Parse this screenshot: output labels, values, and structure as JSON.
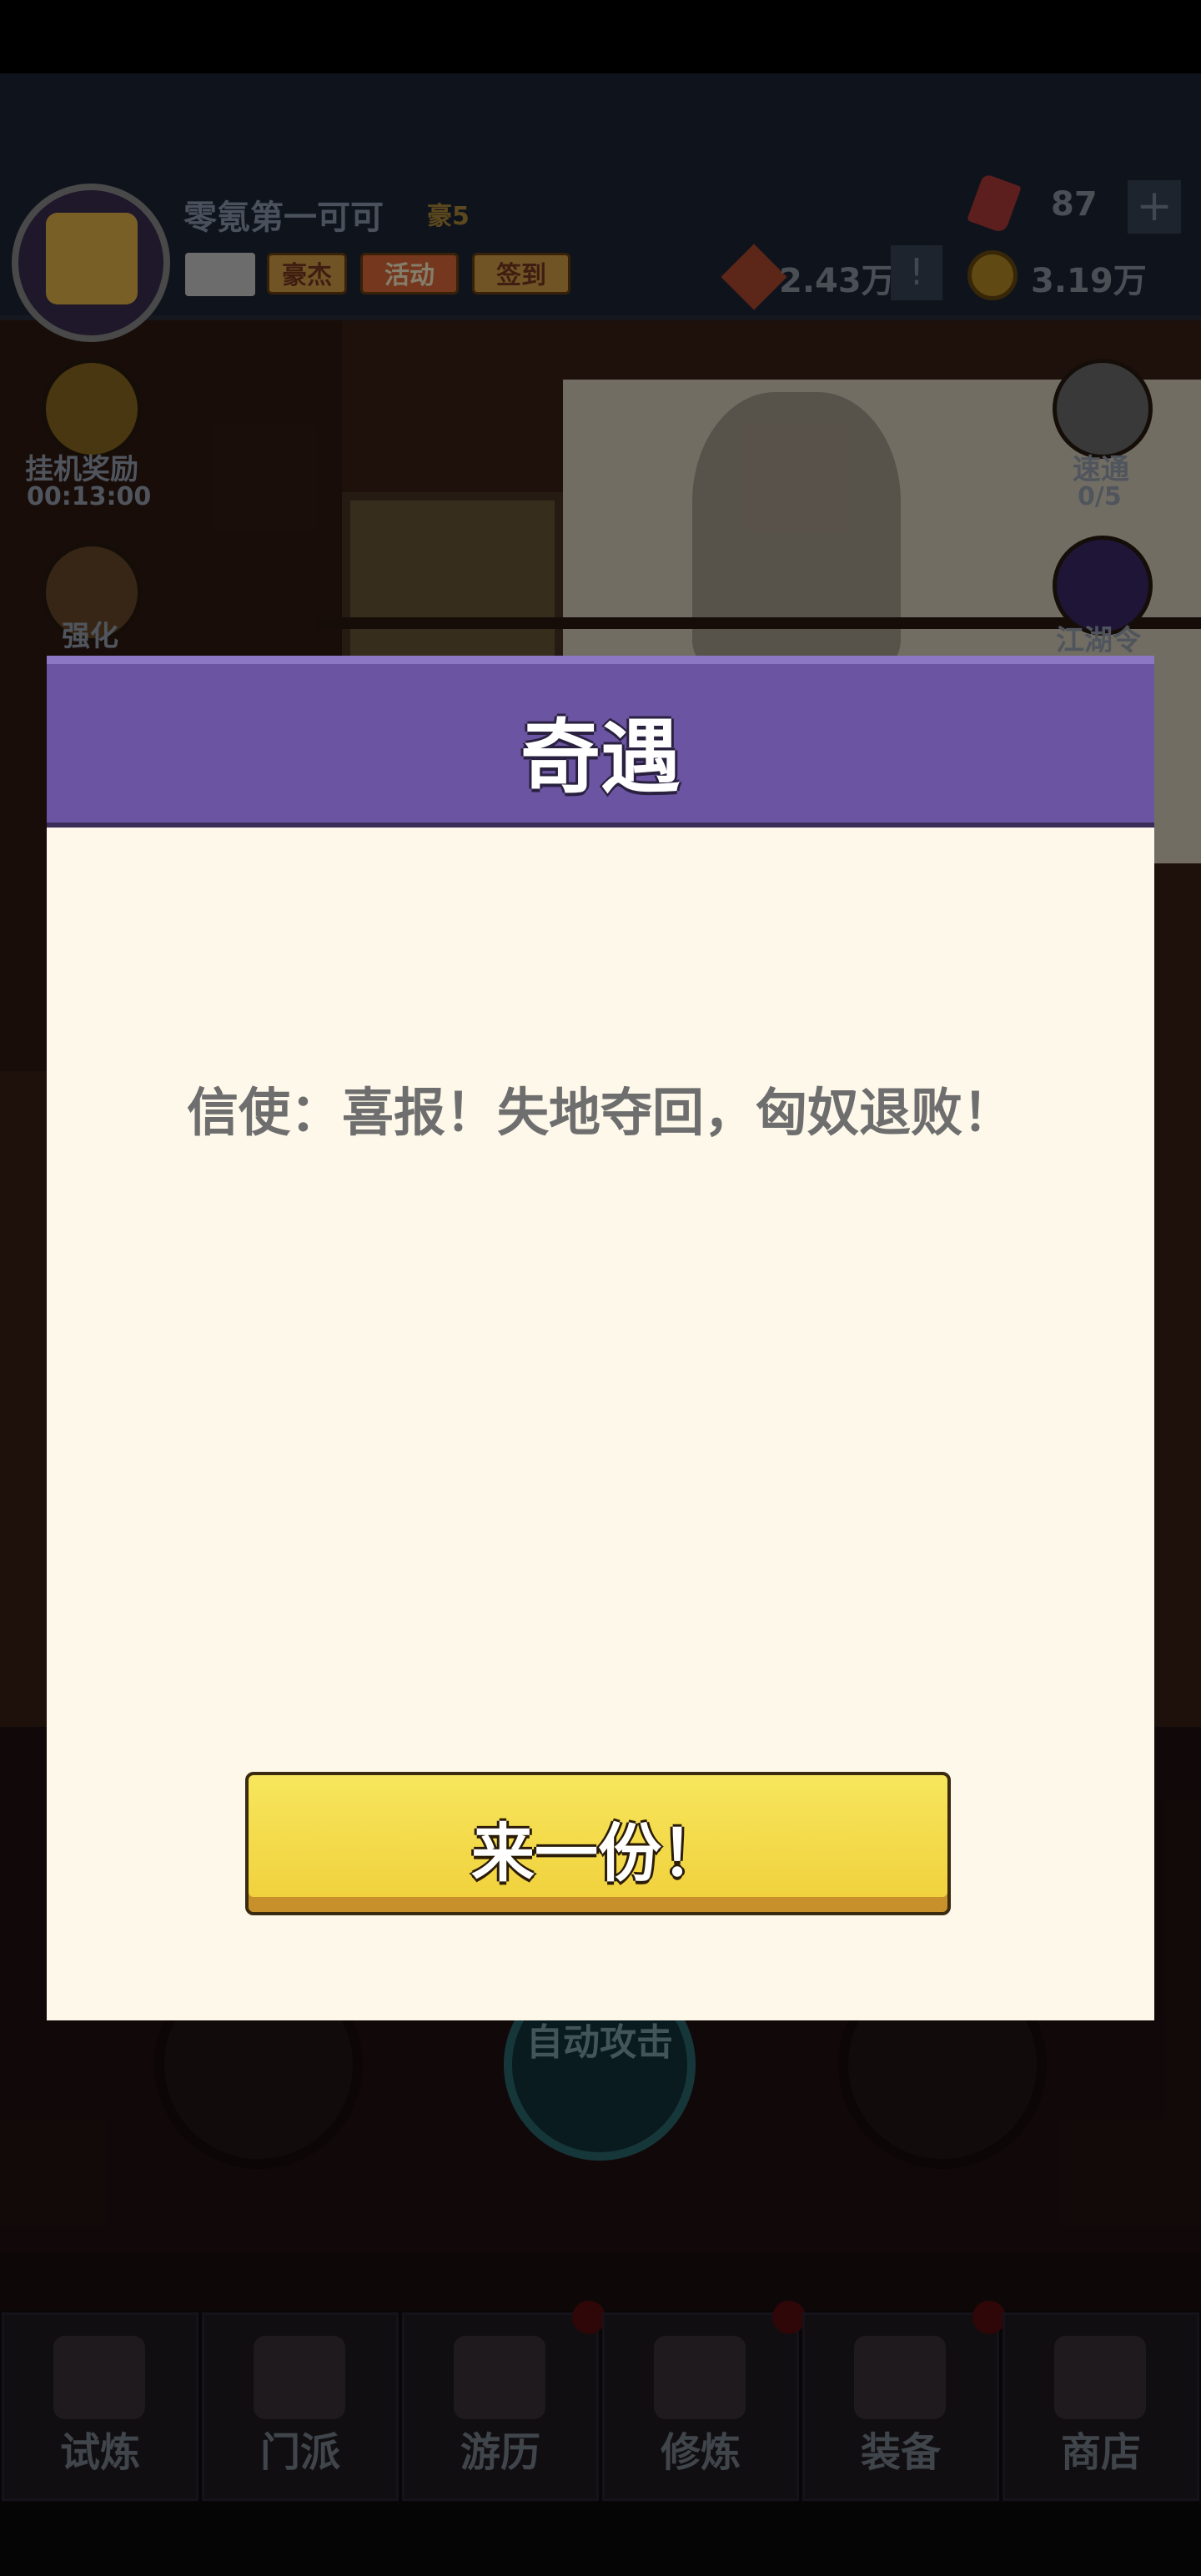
{
  "header": {
    "player_name": "零氪第一可可",
    "rank_tag": "豪5",
    "buttons": {
      "hao": "豪杰",
      "activity": "活动",
      "signin": "签到"
    },
    "gems": "87",
    "power": "2.43万",
    "power_plus": "!",
    "coins": "3.19万",
    "plus": "+"
  },
  "side": {
    "idle_reward_label": "挂机奖励",
    "idle_reward_timer": "00:13:00",
    "enhance_label": "强化",
    "sweep_label": "速通",
    "sweep_count": "0/5",
    "jianghu_label": "江湖令"
  },
  "battle": {
    "auto_attack_label": "自动攻击"
  },
  "nav": {
    "items": [
      {
        "label": "试炼",
        "icon": "ninja-icon"
      },
      {
        "label": "门派",
        "icon": "temple-icon"
      },
      {
        "label": "游历",
        "icon": "mountain-icon"
      },
      {
        "label": "修炼",
        "icon": "scroll-icon"
      },
      {
        "label": "装备",
        "icon": "sword-icon"
      },
      {
        "label": "商店",
        "icon": "shop-icon"
      }
    ]
  },
  "modal": {
    "title": "奇遇",
    "message": "信使：喜报！失地夺回，匈奴退败！",
    "confirm_label": "来一份！"
  },
  "colors": {
    "modal_header": "#6b54a2",
    "modal_body": "#fdf8e9",
    "confirm_button": "#f2d84a"
  }
}
